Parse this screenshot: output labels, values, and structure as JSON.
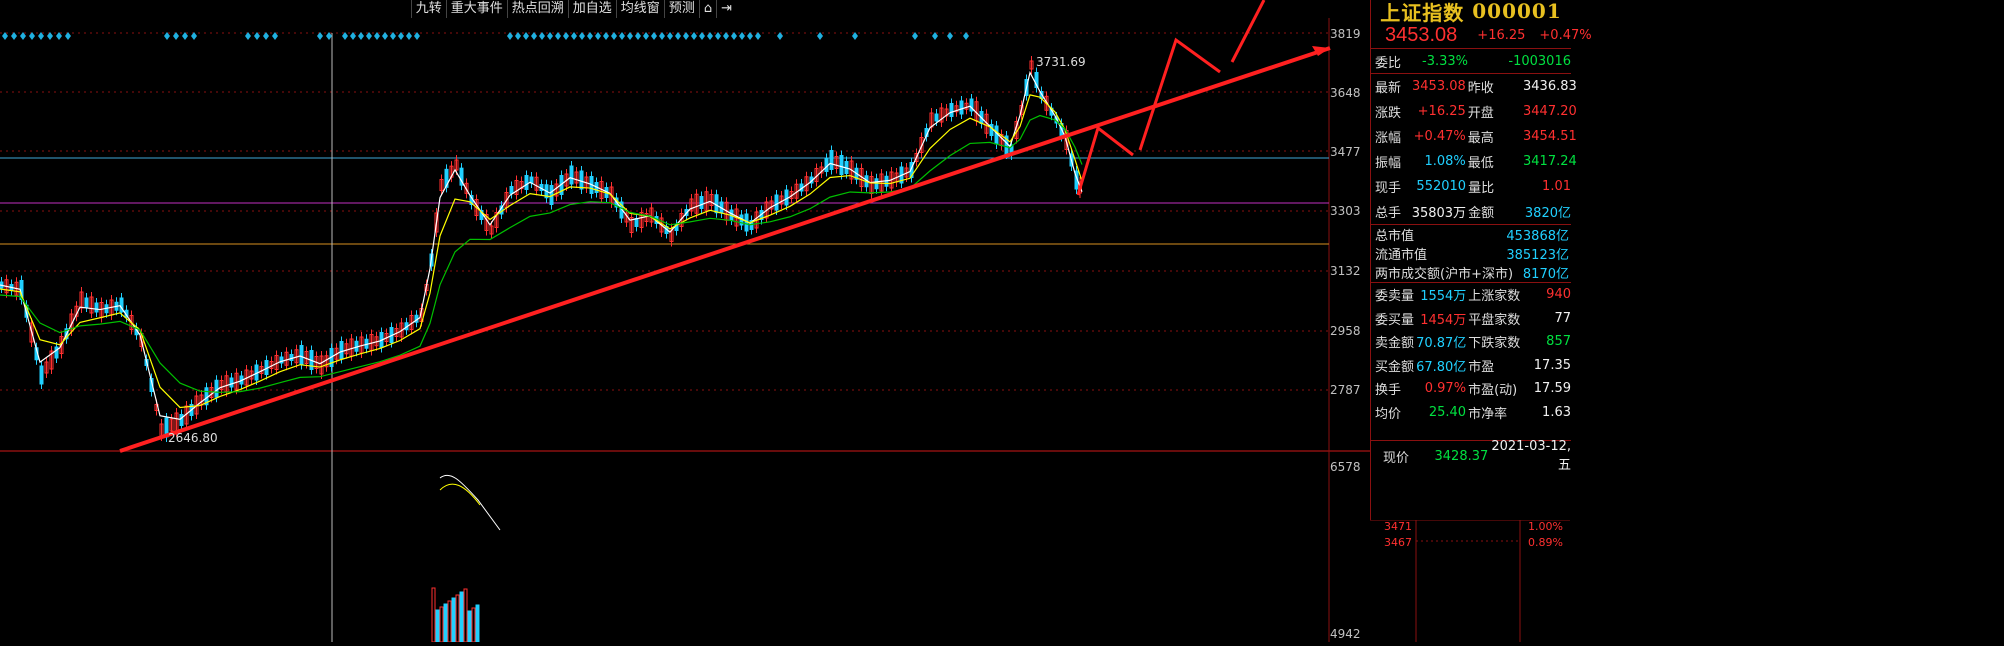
{
  "toolbar": {
    "buttons": [
      "九转",
      "重大事件",
      "热点回溯",
      "加自选",
      "均线窗",
      "预测",
      "⌂",
      "⇥"
    ]
  },
  "chart": {
    "price_axis": [
      "3819",
      "3648",
      "3477",
      "3303",
      "3132",
      "2958",
      "2787"
    ],
    "volume_axis": [
      "6578",
      "4942"
    ],
    "annotations": {
      "high": "3731.69",
      "low": "2646.80"
    },
    "colors": {
      "up": "#ff3030",
      "down": "#20d0ff",
      "ma5": "#ffffff",
      "ma10": "#ffff00",
      "ma20": "#00c000",
      "trendline": "#ff2020",
      "hline_cyan": "#3fa8d8",
      "hline_magenta": "#c030c0",
      "hline_orange": "#d89020",
      "grid": "#8a1010"
    }
  },
  "panel": {
    "name": "上证指数",
    "code": "000001",
    "price": "3453.08",
    "change": "+16.25",
    "change_pct": "+0.47%",
    "weibi": {
      "label": "委比",
      "pct": "-3.33%",
      "diff": "-1003016"
    },
    "rows": [
      {
        "l1": "最新",
        "v1": "3453.08",
        "c1": "red",
        "l2": "昨收",
        "v2": "3436.83",
        "c2": "white"
      },
      {
        "l1": "涨跌",
        "v1": "+16.25",
        "c1": "red",
        "l2": "开盘",
        "v2": "3447.20",
        "c2": "red"
      },
      {
        "l1": "涨幅",
        "v1": "+0.47%",
        "c1": "red",
        "l2": "最高",
        "v2": "3454.51",
        "c2": "red"
      },
      {
        "l1": "振幅",
        "v1": "1.08%",
        "c1": "cyan",
        "l2": "最低",
        "v2": "3417.24",
        "c2": "green"
      },
      {
        "l1": "现手",
        "v1": "552010",
        "c1": "cyan",
        "l2": "量比",
        "v2": "1.01",
        "c2": "red"
      },
      {
        "l1": "总手",
        "v1": "35803万",
        "c1": "white",
        "l2": "金额",
        "v2": "3820亿",
        "c2": "cyan"
      }
    ],
    "cap_rows": [
      {
        "label": "总市值",
        "value": "453868亿"
      },
      {
        "label": "流通市值",
        "value": "385123亿"
      },
      {
        "label": "两市成交额(沪市+深市)",
        "value": "8170亿"
      }
    ],
    "rows2": [
      {
        "l1": "委卖量",
        "v1": "1554万",
        "c1": "cyan",
        "l2": "上涨家数",
        "v2": "940",
        "c2": "red"
      },
      {
        "l1": "委买量",
        "v1": "1454万",
        "c1": "red",
        "l2": "平盘家数",
        "v2": "77",
        "c2": "white"
      },
      {
        "l1": "卖金额",
        "v1": "70.87亿",
        "c1": "cyan",
        "l2": "下跌家数",
        "v2": "857",
        "c2": "green"
      },
      {
        "l1": "买金额",
        "v1": "67.80亿",
        "c1": "cyan",
        "l2": "市盈",
        "v2": "17.35",
        "c2": "white"
      },
      {
        "l1": "换手",
        "v1": "0.97%",
        "c1": "red",
        "l2": "市盈(动)",
        "v2": "17.59",
        "c2": "white"
      },
      {
        "l1": "均价",
        "v1": "25.40",
        "c1": "green",
        "l2": "市净率",
        "v2": "1.63",
        "c2": "white"
      }
    ],
    "current": {
      "label": "现价",
      "price": "3428.37",
      "date": "2021-03-12,五"
    },
    "mini_axis": [
      {
        "price": "3471",
        "pct": "1.00%"
      },
      {
        "price": "3467",
        "pct": "0.89%"
      }
    ]
  }
}
